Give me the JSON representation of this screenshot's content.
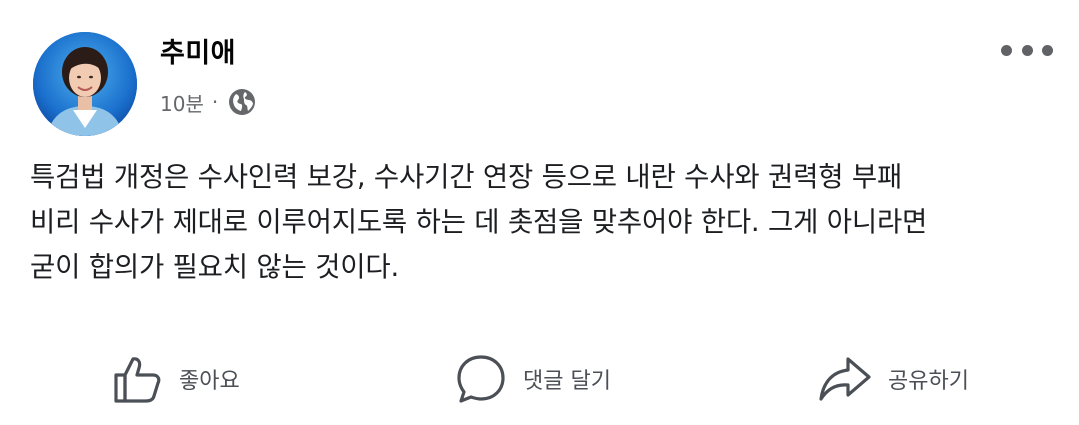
{
  "post": {
    "author": "추미애",
    "time": "10분",
    "separator": "·",
    "privacy_icon": "globe-icon",
    "more_icon": "more-horizontal-icon",
    "text": "특검법 개정은 수사인력 보강, 수사기간 연장 등으로 내란 수사와 권력형 부패\n비리 수사가 제대로 이루어지도록 하는 데 촛점을 맞추어야 한다. 그게 아니라면\n굳이 합의가 필요치 않는 것이다."
  },
  "actions": {
    "like": {
      "label": "좋아요",
      "icon": "thumbs-up-icon"
    },
    "comment": {
      "label": "댓글 달기",
      "icon": "comment-bubble-icon"
    },
    "share": {
      "label": "공유하기",
      "icon": "share-arrow-icon"
    }
  },
  "colors": {
    "text": "#1c1e21",
    "secondary": "#65676b",
    "icon": "#4b4f56",
    "avatar_bg": "#1565c0"
  }
}
